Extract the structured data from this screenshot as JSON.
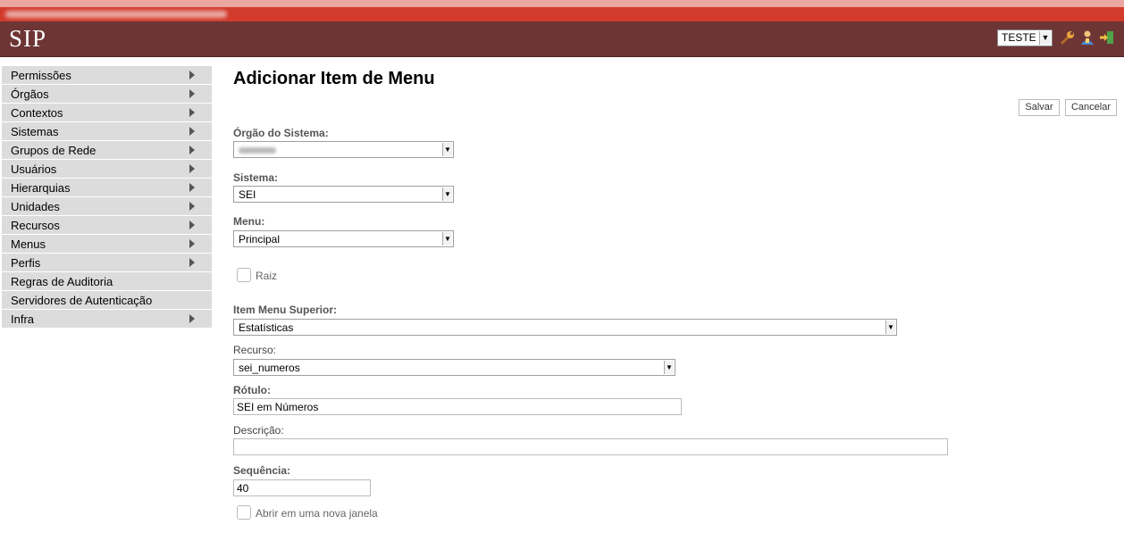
{
  "header": {
    "logo": "SIP",
    "unit_selector": "TESTE",
    "icons": [
      "wrench-icon",
      "user-icon",
      "exit-icon"
    ]
  },
  "sidebar": {
    "items": [
      {
        "label": "Permissões",
        "has_submenu": true
      },
      {
        "label": "Órgãos",
        "has_submenu": true
      },
      {
        "label": "Contextos",
        "has_submenu": true
      },
      {
        "label": "Sistemas",
        "has_submenu": true
      },
      {
        "label": "Grupos de Rede",
        "has_submenu": true
      },
      {
        "label": "Usuários",
        "has_submenu": true
      },
      {
        "label": "Hierarquias",
        "has_submenu": true
      },
      {
        "label": "Unidades",
        "has_submenu": true
      },
      {
        "label": "Recursos",
        "has_submenu": true
      },
      {
        "label": "Menus",
        "has_submenu": true
      },
      {
        "label": "Perfis",
        "has_submenu": true
      },
      {
        "label": "Regras de Auditoria",
        "has_submenu": false
      },
      {
        "label": "Servidores de Autenticação",
        "has_submenu": false
      },
      {
        "label": "Infra",
        "has_submenu": true
      }
    ]
  },
  "main": {
    "title": "Adicionar Item de Menu",
    "save_label": "Salvar",
    "cancel_label": "Cancelar",
    "orgao_label": "Órgão do Sistema:",
    "orgao_value": "",
    "sistema_label": "Sistema:",
    "sistema_value": "SEI",
    "menu_label": "Menu:",
    "menu_value": "Principal",
    "raiz_label": "Raiz",
    "raiz_checked": false,
    "item_superior_label": "Item Menu Superior:",
    "item_superior_value": "Estatísticas",
    "recurso_label": "Recurso:",
    "recurso_value": "sei_numeros",
    "rotulo_label": "Rótulo:",
    "rotulo_value": "SEI em Números",
    "descricao_label": "Descrição:",
    "descricao_value": "",
    "sequencia_label": "Sequência:",
    "sequencia_value": "40",
    "nova_janela_label": "Abrir em uma nova janela",
    "nova_janela_checked": false
  },
  "colors": {
    "header_bg": "#6e3535",
    "top_strip": "#d23b2c",
    "sidebar_item_bg": "#dcdcdc"
  }
}
